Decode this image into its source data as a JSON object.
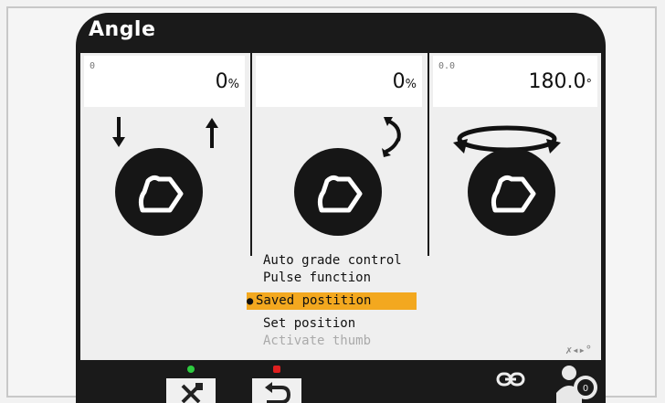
{
  "window": {
    "title": "Angle"
  },
  "panels": [
    {
      "small": "0",
      "value": "0",
      "unit": "%"
    },
    {
      "small": "",
      "value": "0",
      "unit": "%"
    },
    {
      "small": "0.0",
      "value": "180.0",
      "unit": "°"
    }
  ],
  "menu": {
    "items": [
      {
        "label": "Auto grade control"
      },
      {
        "label": "Pulse function"
      },
      {
        "label": "Saved postition",
        "selected": true
      },
      {
        "label": "Set position"
      },
      {
        "label": "Activate thumb",
        "disabled": true
      }
    ]
  },
  "bottom": {
    "settings_button": {
      "icon": "tools-icon",
      "indicator_color": "#2ecc40"
    },
    "back_button": {
      "icon": "undo-arrow-icon",
      "indicator_color": "#e02020"
    },
    "link_icon": "chain-link-icon",
    "user_icon": "operator-profile-icon"
  },
  "colors": {
    "selection": "#f3a81f",
    "background": "#1a1a1a"
  }
}
